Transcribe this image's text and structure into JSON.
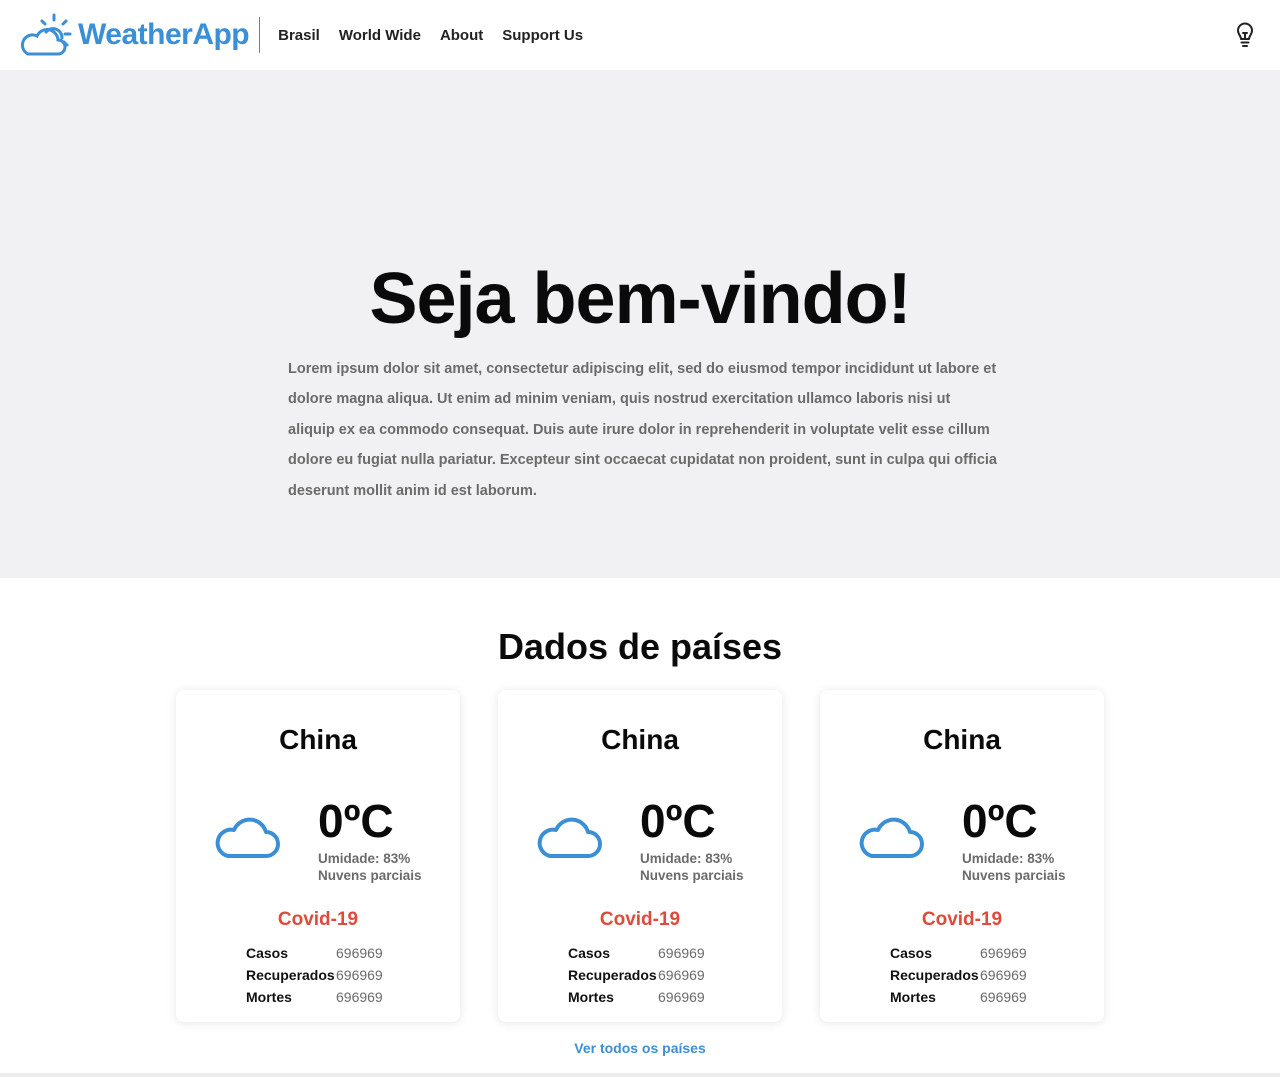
{
  "header": {
    "logo_text": "WeatherApp",
    "nav": [
      {
        "label": "Brasil"
      },
      {
        "label": "World Wide"
      },
      {
        "label": "About"
      },
      {
        "label": "Support Us"
      }
    ]
  },
  "hero": {
    "title": "Seja bem-vindo!",
    "paragraph": "Lorem ipsum dolor sit amet, consectetur adipiscing elit, sed do eiusmod tempor incididunt ut labore et dolore magna aliqua. Ut enim ad minim veniam, quis nostrud exercitation ullamco laboris nisi ut aliquip ex ea commodo consequat. Duis aute irure dolor in reprehenderit in voluptate velit esse cillum dolore eu fugiat nulla pariatur. Excepteur sint occaecat cupidatat non proident, sunt in culpa qui officia deserunt mollit anim id est laborum."
  },
  "countries": {
    "title": "Dados de países",
    "cards": [
      {
        "country": "China",
        "temp": "0ºC",
        "humidity": "Umidade: 83%",
        "condition": "Nuvens parciais",
        "covid_title": "Covid-19",
        "stats": [
          {
            "label": "Casos",
            "value": "696969"
          },
          {
            "label": "Recuperados",
            "value": "696969"
          },
          {
            "label": "Mortes",
            "value": "696969"
          }
        ]
      },
      {
        "country": "China",
        "temp": "0ºC",
        "humidity": "Umidade: 83%",
        "condition": "Nuvens parciais",
        "covid_title": "Covid-19",
        "stats": [
          {
            "label": "Casos",
            "value": "696969"
          },
          {
            "label": "Recuperados",
            "value": "696969"
          },
          {
            "label": "Mortes",
            "value": "696969"
          }
        ]
      },
      {
        "country": "China",
        "temp": "0ºC",
        "humidity": "Umidade: 83%",
        "condition": "Nuvens parciais",
        "covid_title": "Covid-19",
        "stats": [
          {
            "label": "Casos",
            "value": "696969"
          },
          {
            "label": "Recuperados",
            "value": "696969"
          },
          {
            "label": "Mortes",
            "value": "696969"
          }
        ]
      }
    ],
    "see_all": "Ver todos os países"
  },
  "icons": {
    "logo": "cloud-sun-icon",
    "weather": "cloud-icon",
    "theme": "lightbulb-icon"
  },
  "colors": {
    "brand": "#3a8fd6",
    "covid": "#e04a3b",
    "hero_bg": "#f1f1f3"
  }
}
